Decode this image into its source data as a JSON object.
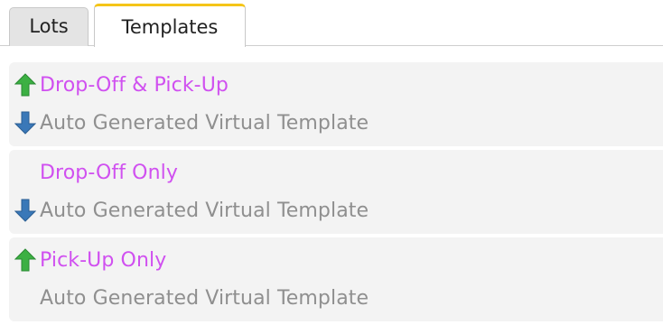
{
  "tabs": [
    {
      "label": "Lots",
      "active": false
    },
    {
      "label": "Templates",
      "active": true
    }
  ],
  "colors": {
    "active_tab_accent": "#f5c518",
    "template_name": "#d050f0",
    "subtext": "#8f8f8f",
    "arrow_up": "#3cb043",
    "arrow_down": "#3a78b8"
  },
  "templates": [
    {
      "name": "Drop-Off & Pick-Up",
      "name_icon": "green-up-arrow-icon",
      "subtitle": "Auto Generated Virtual Template",
      "subtitle_icon": "blue-down-arrow-icon"
    },
    {
      "name": "Drop-Off Only",
      "name_icon": null,
      "subtitle": "Auto Generated Virtual Template",
      "subtitle_icon": "blue-down-arrow-icon"
    },
    {
      "name": "Pick-Up Only",
      "name_icon": "green-up-arrow-icon",
      "subtitle": "Auto Generated Virtual Template",
      "subtitle_icon": null
    }
  ]
}
